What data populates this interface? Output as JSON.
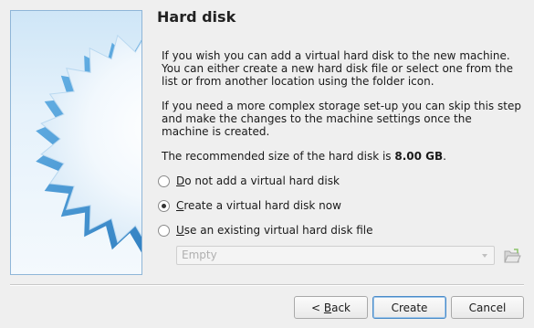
{
  "page": {
    "title": "Hard disk",
    "paragraph_1": "If you wish you can add a virtual hard disk to the new machine. You can either create a new hard disk file or select one from the list or from another location using the folder icon.",
    "paragraph_2": "If you need a more complex storage set-up you can skip this step and make the changes to the machine settings once the machine is created.",
    "recommended_prefix": "The recommended size of the hard disk is ",
    "recommended_value": "8.00 GB",
    "recommended_suffix": "."
  },
  "options": {
    "no_disk": {
      "mnemonic": "D",
      "rest": "o not add a virtual hard disk",
      "selected": false
    },
    "create_new": {
      "mnemonic": "C",
      "rest": "reate a virtual hard disk now",
      "selected": true
    },
    "use_existing": {
      "mnemonic": "U",
      "rest": "se an existing virtual hard disk file",
      "selected": false
    }
  },
  "existing_disk_combo": {
    "value": "Empty",
    "enabled": false
  },
  "buttons": {
    "back_prefix": "< ",
    "back_mnemonic": "B",
    "back_rest": "ack",
    "create": "Create",
    "cancel": "Cancel"
  },
  "icons": {
    "side_image": "virtualbox-wizard-star-image",
    "folder": "folder-open-icon"
  },
  "colors": {
    "accent": "#4a8bc8",
    "star_blue": "#3c97d9",
    "side_bg": "#cfe6f7"
  }
}
